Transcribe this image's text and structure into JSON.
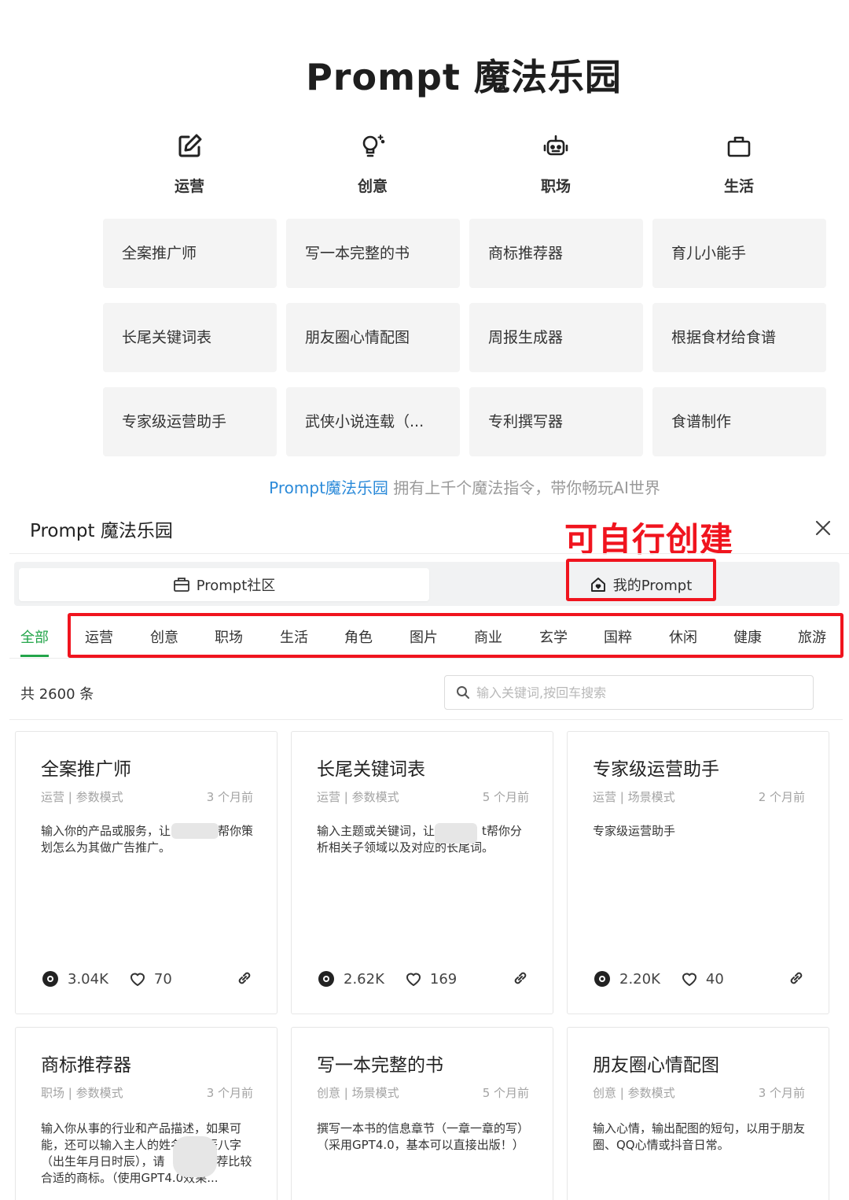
{
  "hero": {
    "title": "Prompt 魔法乐园",
    "categories": [
      {
        "label": "运营",
        "icon": "edit-icon"
      },
      {
        "label": "创意",
        "icon": "lightbulb-icon"
      },
      {
        "label": "职场",
        "icon": "robot-icon"
      },
      {
        "label": "生活",
        "icon": "briefcase-icon"
      }
    ],
    "tiles": [
      [
        "全案推广师",
        "长尾关键词表",
        "专家级运营助手"
      ],
      [
        "写一本完整的书",
        "朋友圈心情配图",
        "武侠小说连载（..."
      ],
      [
        "商标推荐器",
        "周报生成器",
        "专利撰写器"
      ],
      [
        "育儿小能手",
        "根据食材给食谱",
        "食谱制作"
      ]
    ],
    "promo_brand": "Prompt魔法乐园",
    "promo_text": " 拥有上千个魔法指令，带你畅玩AI世界"
  },
  "panel": {
    "title": "Prompt 魔法乐园",
    "annotation": "可自行创建",
    "tabs": {
      "community": "Prompt社区",
      "mine": "我的Prompt"
    },
    "filters": [
      "全部",
      "运营",
      "创意",
      "职场",
      "生活",
      "角色",
      "图片",
      "商业",
      "玄学",
      "国粹",
      "休闲",
      "健康",
      "旅游"
    ],
    "count_text": "共 2600 条",
    "search_placeholder": "输入关键词,按回车搜索"
  },
  "cards": [
    {
      "title": "全案推广师",
      "tags": "运营 | 参数模式",
      "time": "3 个月前",
      "desc": "输入你的产品或服务，让　　　　帮你策划怎么为其做广告推广。",
      "views": "3.04K",
      "likes": "70"
    },
    {
      "title": "长尾关键词表",
      "tags": "运营 | 参数模式",
      "time": "5 个月前",
      "desc": "输入主题或关键词，让　　　　t帮你分析相关子领域以及对应的长尾词。",
      "views": "2.62K",
      "likes": "169"
    },
    {
      "title": "专家级运营助手",
      "tags": "运营 | 场景模式",
      "time": "2 个月前",
      "desc": "专家级运营助手",
      "views": "2.20K",
      "likes": "40"
    },
    {
      "title": "商标推荐器",
      "tags": "职场 | 参数模式",
      "time": "3 个月前",
      "desc": "输入你从事的行业和产品描述，如果可能，还可以输入主人的姓名　　辰八字（出生年月日时辰），请　　　t推荐比较合适的商标。（使用GPT4.0效果...",
      "views": "",
      "likes": ""
    },
    {
      "title": "写一本完整的书",
      "tags": "创意 | 场景模式",
      "time": "5 个月前",
      "desc": "撰写一本书的信息章节（一章一章的写）（采用GPT4.0，基本可以直接出版！）",
      "views": "",
      "likes": ""
    },
    {
      "title": "朋友圈心情配图",
      "tags": "创意 | 参数模式",
      "time": "3 个月前",
      "desc": "输入心情，输出配图的短句，以用于朋友圈、QQ心情或抖音日常。",
      "views": "",
      "likes": ""
    }
  ]
}
